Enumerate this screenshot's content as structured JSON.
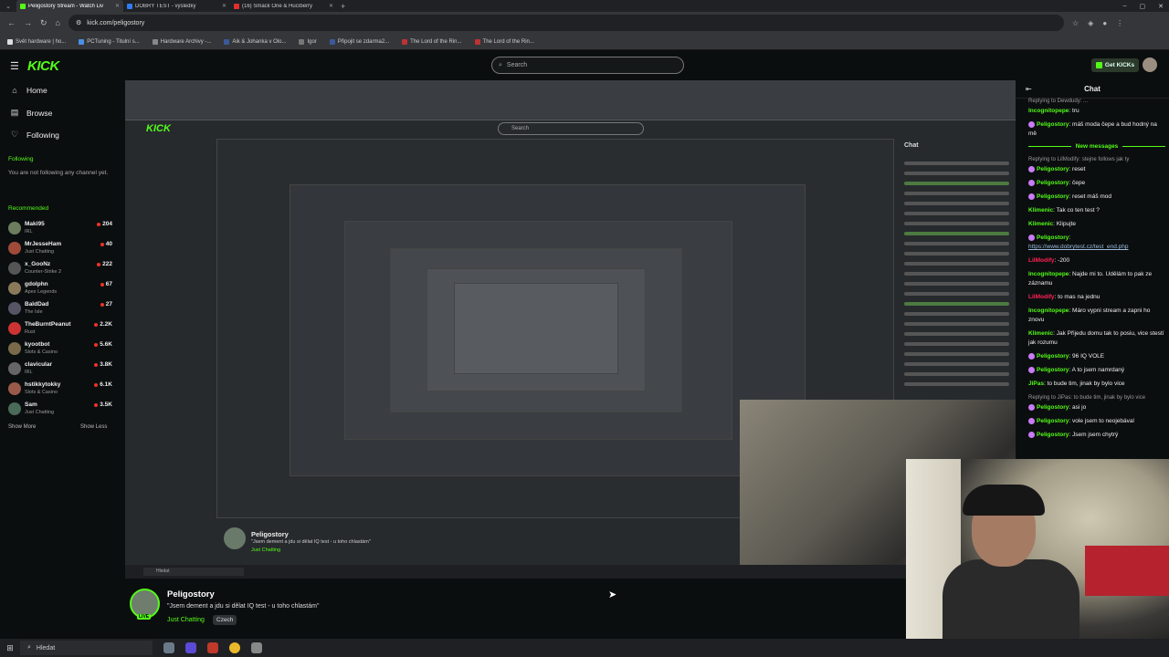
{
  "browser": {
    "tabs": [
      {
        "label": "Peligostory Stream - Watch Liv",
        "color": "#53fc18"
      },
      {
        "label": "DOBRÝ TEST - výsledky",
        "color": "#2f7cf6"
      },
      {
        "label": "(16) Smack One & Hucíberry",
        "color": "#e02f2f"
      }
    ],
    "url": "kick.com/peligostory",
    "bookmarks": [
      {
        "label": "Svět hardware | ho...",
        "color": "#ddd"
      },
      {
        "label": "PCTuning - Titulní s...",
        "color": "#4a90e2"
      },
      {
        "label": "Hardware Archivy -...",
        "color": "#888"
      },
      {
        "label": "Aik & Johanka v Olo...",
        "color": "#3b5998"
      },
      {
        "label": "Igor",
        "color": "#777"
      },
      {
        "label": "Připojit se zdarma2...",
        "color": "#3b5998"
      },
      {
        "label": "The Lord of the Rin...",
        "color": "#b33"
      },
      {
        "label": "The Lord of the Rin...",
        "color": "#b33"
      }
    ]
  },
  "kick": {
    "logo": "KICK",
    "search_placeholder": "Search",
    "get_kicks": "Get KICKs"
  },
  "sidebar": {
    "nav": [
      {
        "label": "Home",
        "icon": "home-icon"
      },
      {
        "label": "Browse",
        "icon": "browse-icon"
      },
      {
        "label": "Following",
        "icon": "heart-icon"
      }
    ],
    "following_title": "Following",
    "following_note": "You are not following any channel yet.",
    "recommended_title": "Recommended",
    "recommended": [
      {
        "name": "Maki95",
        "category": "IRL",
        "viewers": "204",
        "color": "#6b7d5e"
      },
      {
        "name": "MrJesseHam",
        "category": "Just Chatting",
        "viewers": "40",
        "color": "#a04a3a"
      },
      {
        "name": "x_GooNz",
        "category": "Counter-Strike 2",
        "viewers": "222",
        "color": "#555"
      },
      {
        "name": "gdolphn",
        "category": "Apex Legends",
        "viewers": "67",
        "color": "#8a7a5a"
      },
      {
        "name": "BaldDad",
        "category": "The Isle",
        "viewers": "27",
        "color": "#556"
      },
      {
        "name": "TheBurntPeanut",
        "category": "Rust",
        "viewers": "2.2K",
        "color": "#c33"
      },
      {
        "name": "kyootbot",
        "category": "Slots & Casino",
        "viewers": "5.6K",
        "color": "#7a6a4a"
      },
      {
        "name": "clavicular",
        "category": "IRL",
        "viewers": "3.8K",
        "color": "#666"
      },
      {
        "name": "hstikkytokky",
        "category": "Slots & Casino",
        "viewers": "6.1K",
        "color": "#9a5a4a"
      },
      {
        "name": "Sam",
        "category": "Just Chatting",
        "viewers": "3.5K",
        "color": "#4a6a5a"
      }
    ],
    "show_more": "Show More",
    "show_less": "Show Less"
  },
  "inner": {
    "logo": "KICK",
    "search": "Search",
    "chat": "Chat",
    "name": "Peligostory",
    "title": "\"Jsem dement a jdu si dělat IQ test - u toho chlastám\"",
    "category": "Just Chatting",
    "taskbar_search": "Hledat"
  },
  "stream_info": {
    "name": "Peligostory",
    "title": "\"Jsem dement a jdu si dělat IQ test - u toho chlastám\"",
    "category": "Just Chatting",
    "language": "Czech",
    "live": "LIVE"
  },
  "chat": {
    "title": "Chat",
    "new_messages": "New messages",
    "messages": [
      {
        "reply": "Replying to Dewdudy: ...",
        "user": "Incognitopepe",
        "color": "#53fc18",
        "text": "tru",
        "badge": false
      },
      {
        "user": "Peligostory",
        "color": "#53fc18",
        "text": "máš moda čepe a bud hodný na mě",
        "badge": true
      },
      {
        "divider": true
      },
      {
        "reply": "Replying to LilModify: stejne follows jak ty",
        "user": "Peligostory",
        "color": "#53fc18",
        "text": "reset",
        "badge": true
      },
      {
        "user": "Peligostory",
        "color": "#53fc18",
        "text": "čepe",
        "badge": true
      },
      {
        "user": "Peligostory",
        "color": "#53fc18",
        "text": "reset máš mod",
        "badge": true
      },
      {
        "user": "Klimenic",
        "color": "#53fc18",
        "text": "Tak co ten test ?",
        "badge": false
      },
      {
        "user": "Klimenic",
        "color": "#53fc18",
        "text": "Klipujte",
        "badge": false
      },
      {
        "user": "Peligostory",
        "color": "#53fc18",
        "text": "",
        "badge": true,
        "link": "https://www.dobrytest.cz/test_end.php"
      },
      {
        "user": "LilModify",
        "color": "#f25",
        "text": "-200",
        "badge": false
      },
      {
        "user": "Incognitopepe",
        "color": "#53fc18",
        "text": "Najde mi to. Udělám to pak ze záznamu",
        "badge": false
      },
      {
        "user": "LilModify",
        "color": "#f25",
        "text": "to mas na jednu",
        "badge": false
      },
      {
        "user": "Incognitopepe",
        "color": "#53fc18",
        "text": "Máro vypni stream a zapni ho znovu",
        "badge": false
      },
      {
        "user": "Klimenic",
        "color": "#53fc18",
        "text": "Jak Přijedu domu tak to posiu, vice stestí jak rozumu",
        "badge": false
      },
      {
        "user": "Peligostory",
        "color": "#53fc18",
        "text": "96 IQ VOLE",
        "badge": true
      },
      {
        "user": "Peligostory",
        "color": "#53fc18",
        "text": "A to jsem namrdaný",
        "badge": true
      },
      {
        "user": "JiPas",
        "color": "#53fc18",
        "text": "to bude tim, jinak by bylo vice",
        "badge": false
      },
      {
        "reply": "Replying to JiPas: to bude tim, jinak by bylo vice",
        "user": "Peligostory",
        "color": "#53fc18",
        "text": "asi jo",
        "badge": true
      },
      {
        "user": "Peligostory",
        "color": "#53fc18",
        "text": "vole jsem to neojebával",
        "badge": true
      },
      {
        "user": "Peligostory",
        "color": "#53fc18",
        "text": "Jsem jsem chytrý",
        "badge": true
      }
    ]
  },
  "taskbar": {
    "search": "Hledat"
  }
}
